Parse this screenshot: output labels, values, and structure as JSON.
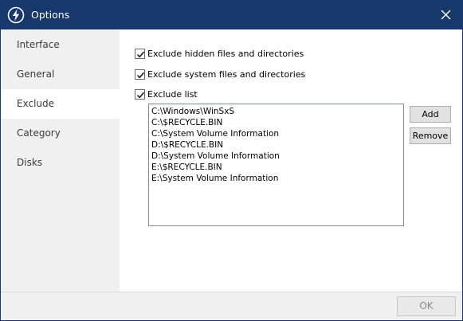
{
  "window": {
    "title": "Options",
    "close_icon": "close-icon",
    "app_icon": "lightning-bolt-icon",
    "colors": {
      "titlebar": "#17386a",
      "sidebar": "#f0f0f0",
      "footer": "#f0f0f0"
    }
  },
  "sidebar": {
    "items": [
      {
        "label": "Interface",
        "active": false
      },
      {
        "label": "General",
        "active": false
      },
      {
        "label": "Exclude",
        "active": true
      },
      {
        "label": "Category",
        "active": false
      },
      {
        "label": "Disks",
        "active": false
      }
    ]
  },
  "exclude": {
    "hidden_label": "Exclude hidden files and directories",
    "hidden_checked": true,
    "system_label": "Exclude system files and directories",
    "system_checked": true,
    "list_label": "Exclude list",
    "list_checked": true,
    "list": [
      "C:\\Windows\\WinSxS",
      "C:\\$RECYCLE.BIN",
      "C:\\System Volume Information",
      "D:\\$RECYCLE.BIN",
      "D:\\System Volume Information",
      "E:\\$RECYCLE.BIN",
      "E:\\System Volume Information"
    ],
    "add_label": "Add",
    "remove_label": "Remove"
  },
  "footer": {
    "ok_label": "OK"
  }
}
